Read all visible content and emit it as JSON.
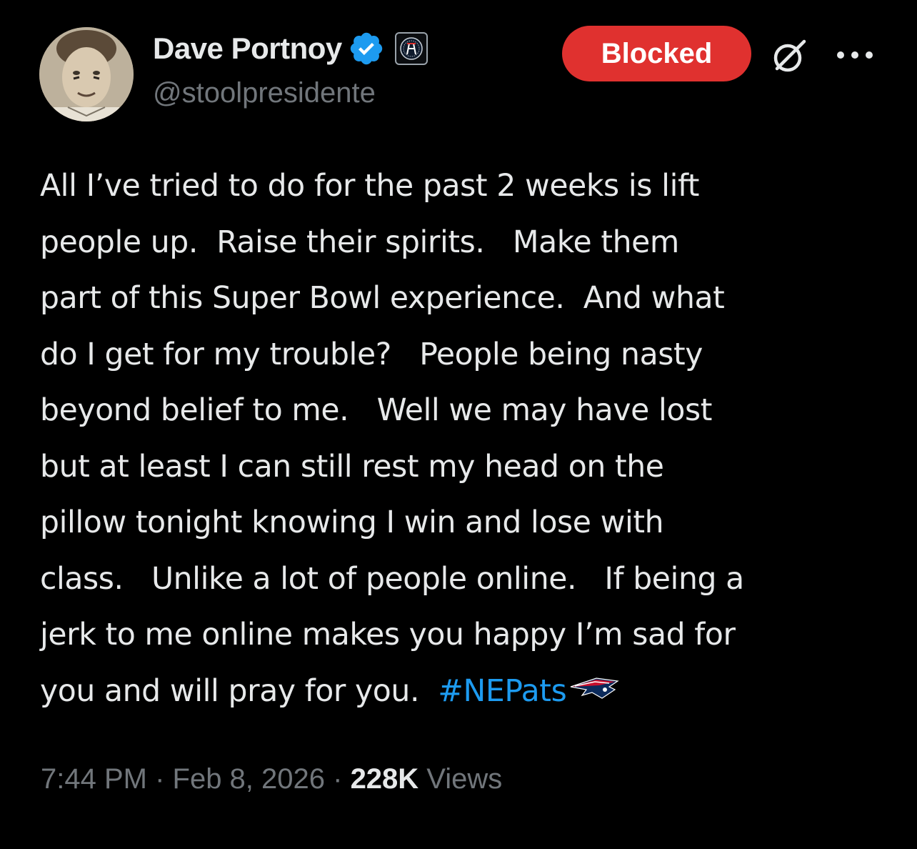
{
  "colors": {
    "background": "#000000",
    "primary_text": "#e7e9ea",
    "secondary_text": "#71767b",
    "link": "#1d9bf0",
    "blocked_red": "#e0312f",
    "verified_blue": "#1d9bf0"
  },
  "author": {
    "display_name": "Dave Portnoy",
    "handle": "@stoolpresidente",
    "avatar_icon": "profile-photo",
    "verified_icon": "verified-badge-icon",
    "affiliate_icon": "barstool-affiliate-badge-icon"
  },
  "actions": {
    "blocked_label": "Blocked",
    "grok_icon": "grok-icon",
    "more_icon": "more-options-icon"
  },
  "tweet": {
    "lines": [
      "All I’ve tried to do for the past 2 weeks is lift",
      "people up.  Raise their spirits.   Make them",
      "part of this Super Bowl experience.  And what",
      "do I get for my trouble?   People being nasty",
      "beyond belief to me.   Well we may have lost",
      "but at least I can still rest my head on the",
      "pillow tonight knowing I win and lose with",
      "class.   Unlike a lot of people online.   If being a",
      "jerk to me online makes you happy I’m sad for"
    ],
    "last_line_text": "you and will pray for you.  ",
    "hashtag": "#NEPats",
    "hashtag_emoji": "patriots-logo-icon"
  },
  "meta": {
    "time": "7:44 PM",
    "separator": " · ",
    "date": "Feb 8, 2026",
    "views_count": "228K",
    "views_label": " Views"
  }
}
